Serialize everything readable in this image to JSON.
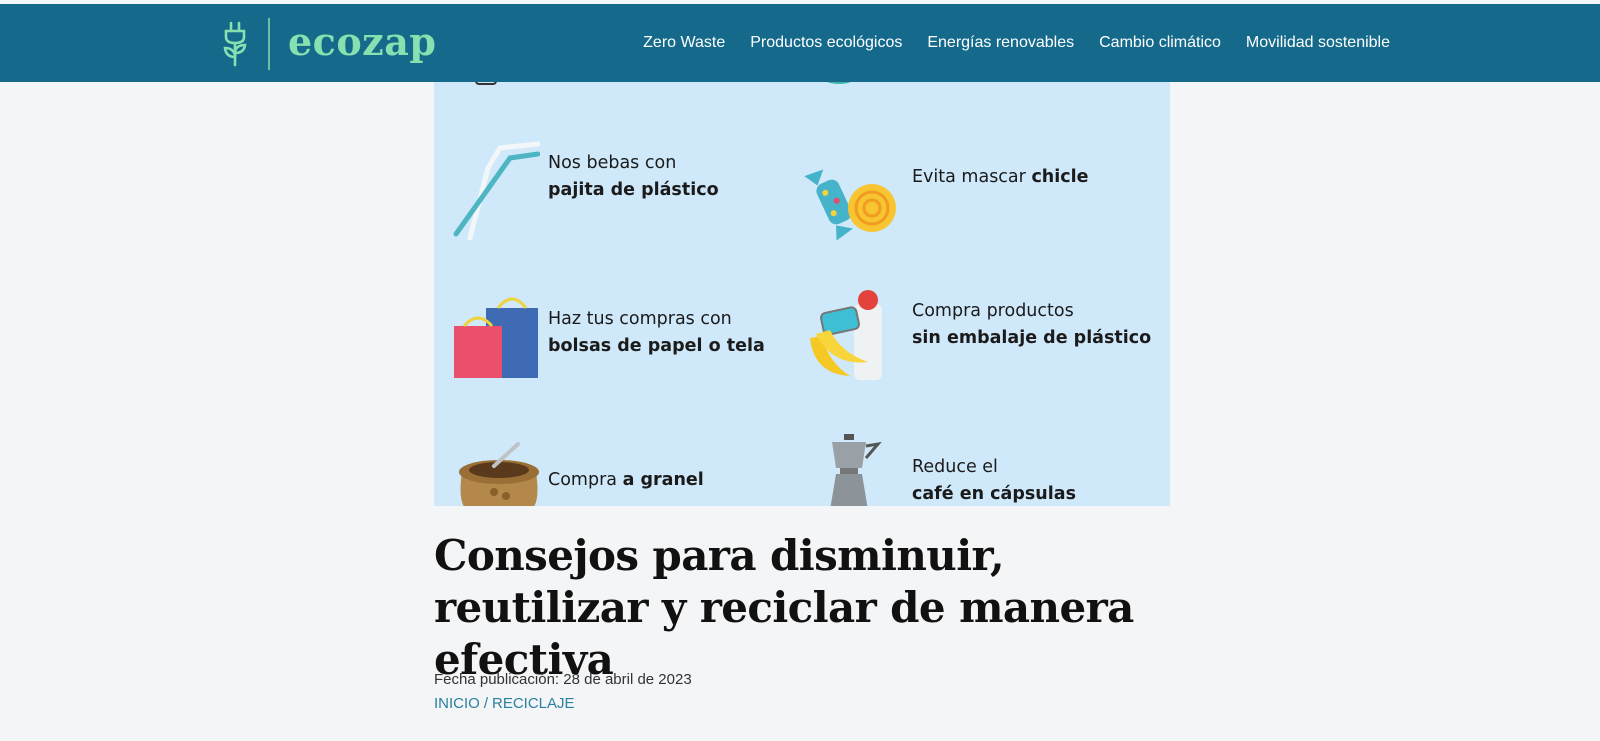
{
  "site": {
    "logo_text": "ecozap"
  },
  "nav": {
    "items": [
      {
        "label": "Zero Waste"
      },
      {
        "label": "Productos ecológicos"
      },
      {
        "label": "Energías renovables"
      },
      {
        "label": "Cambio climático"
      },
      {
        "label": "Movilidad sostenible"
      }
    ]
  },
  "hero": {
    "tips": [
      {
        "line1": "Nos bebas con",
        "bold": "pajita de plástico",
        "icon": "straw-icon"
      },
      {
        "line1": "Evita mascar",
        "bold": "chicle",
        "icon": "candy-icon"
      },
      {
        "line1": "Haz tus compras con",
        "bold": "bolsas de papel o tela",
        "icon": "shopping-bags-icon"
      },
      {
        "line1": "Compra productos",
        "bold": "sin embalaje de plástico",
        "icon": "groceries-icon"
      },
      {
        "line1": "Compra",
        "bold": "a granel",
        "icon": "bulk-sack-icon"
      },
      {
        "line1": "Reduce el",
        "bold": "café en cápsulas",
        "icon": "coffee-pot-icon"
      }
    ]
  },
  "article": {
    "title": "Consejos para disminuir, reutilizar y reciclar de manera efectiva",
    "date": "Fecha publicación: 28 de abril de 2023",
    "breadcrumb": {
      "home": "INICIO",
      "separator": "/",
      "category": "RECICLAJE"
    }
  },
  "colors": {
    "header": "#156a8c",
    "logo": "#86e0b0",
    "hero_bg": "#cfe9fa",
    "link": "#2b7fa0"
  }
}
